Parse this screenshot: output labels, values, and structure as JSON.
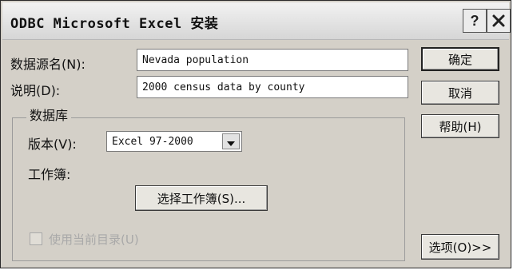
{
  "window": {
    "title": "ODBC Microsoft Excel 安装",
    "help_icon": "question-icon",
    "close_icon": "close-icon"
  },
  "fields": {
    "datasource_label": "数据源名(N):",
    "datasource_value": "Nevada population",
    "description_label": "说明(D):",
    "description_value": "2000 census data by county"
  },
  "database": {
    "group_title": "数据库",
    "version_label": "版本(V):",
    "version_value": "Excel 97-2000",
    "workbook_label": "工作簿:",
    "select_workbook_button": "选择工作簿(S)...",
    "use_current_dir_label": "使用当前目录(U)",
    "use_current_dir_checked": false
  },
  "buttons": {
    "ok": "确定",
    "cancel": "取消",
    "help": "帮助(H)",
    "options": "选项(O)>>"
  }
}
